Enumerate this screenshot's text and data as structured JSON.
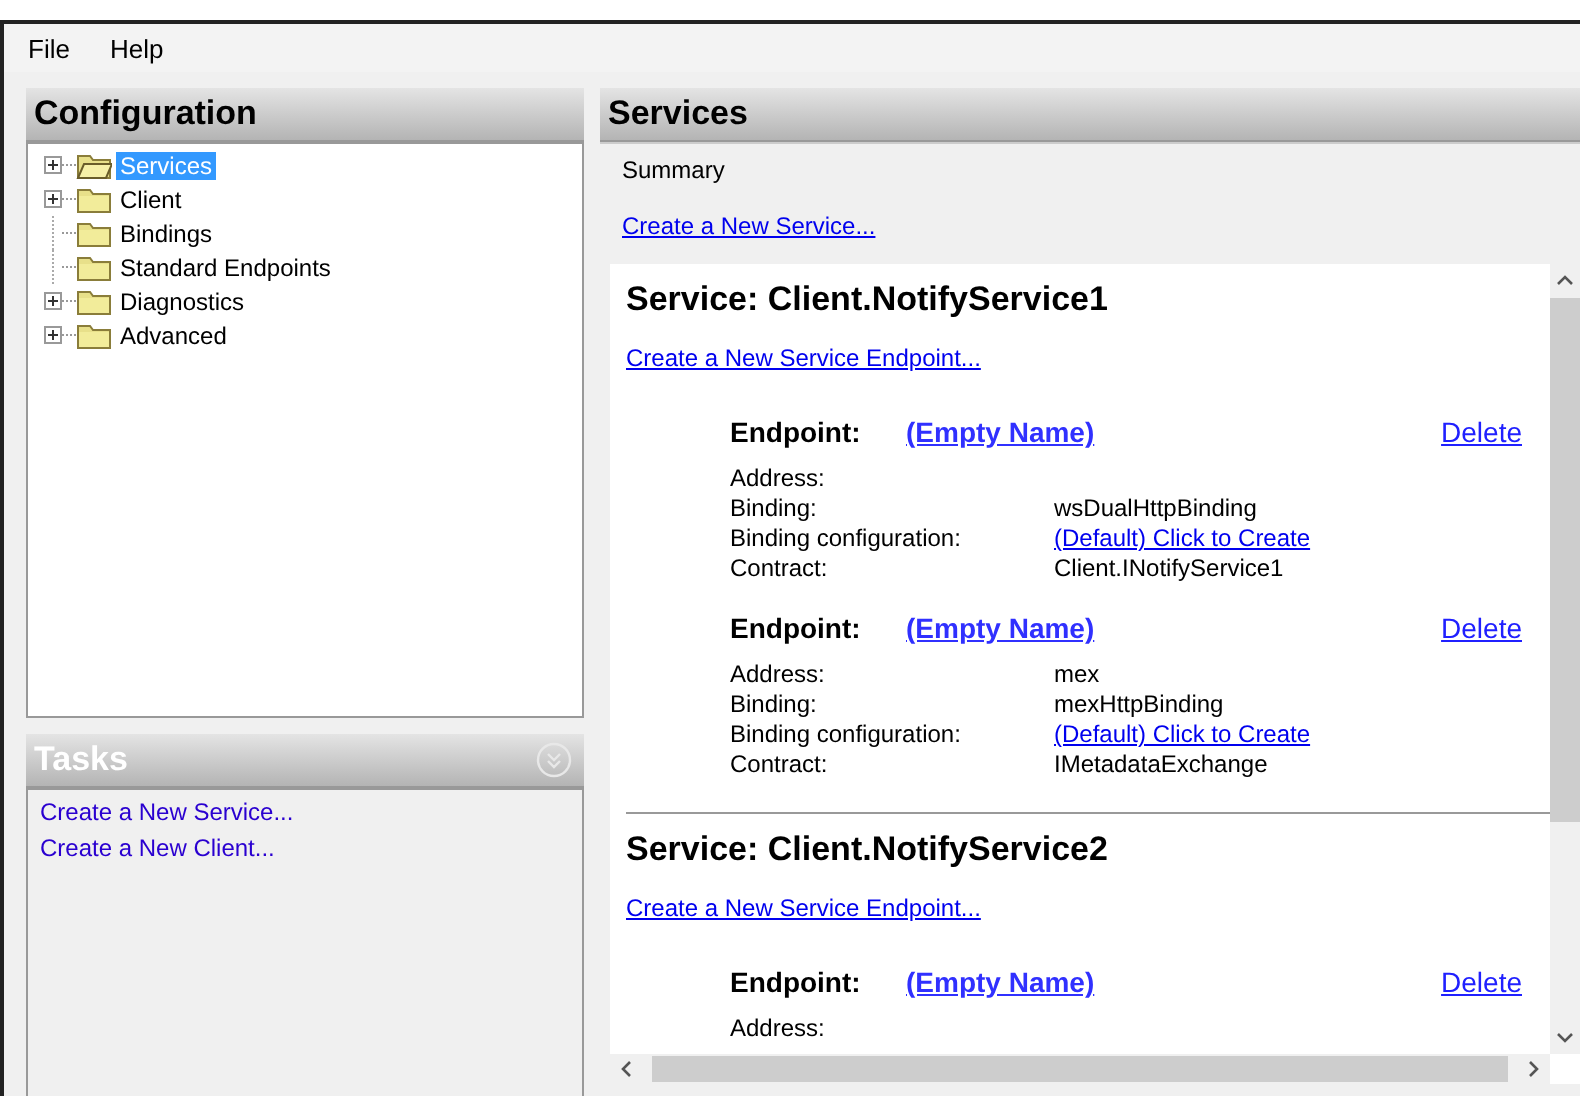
{
  "menu": [
    "File",
    "Help"
  ],
  "configuration": {
    "title": "Configuration",
    "tree": [
      {
        "label": "Services",
        "expandable": true,
        "selected": true,
        "open_folder": true
      },
      {
        "label": "Client",
        "expandable": true,
        "selected": false,
        "open_folder": false
      },
      {
        "label": "Bindings",
        "expandable": false,
        "selected": false,
        "open_folder": false
      },
      {
        "label": "Standard Endpoints",
        "expandable": false,
        "selected": false,
        "open_folder": false
      },
      {
        "label": "Diagnostics",
        "expandable": true,
        "selected": false,
        "open_folder": false
      },
      {
        "label": "Advanced",
        "expandable": true,
        "selected": false,
        "open_folder": false
      }
    ]
  },
  "tasks": {
    "title": "Tasks",
    "links": [
      "Create a New Service...",
      "Create a New Client..."
    ]
  },
  "services_panel": {
    "title": "Services",
    "summary_label": "Summary",
    "create_link": "Create a New Service...",
    "services": [
      {
        "title": "Service: Client.NotifyService1",
        "create_endpoint_link": "Create a New Service Endpoint...",
        "endpoints": [
          {
            "label": "Endpoint:",
            "name": "(Empty Name)",
            "delete": "Delete",
            "properties": [
              {
                "label": "Address:"
              },
              {
                "label": "Binding:",
                "value": "wsDualHttpBinding",
                "kind": "text"
              },
              {
                "label": "Binding configuration:",
                "value": "(Default) Click to Create",
                "kind": "link"
              },
              {
                "label": "Contract:",
                "value": "Client.INotifyService1",
                "kind": "text"
              }
            ]
          },
          {
            "label": "Endpoint:",
            "name": "(Empty Name)",
            "delete": "Delete",
            "properties": [
              {
                "label": "Address:",
                "value": "mex",
                "kind": "text"
              },
              {
                "label": "Binding:",
                "value": "mexHttpBinding",
                "kind": "text"
              },
              {
                "label": "Binding configuration:",
                "value": "(Default) Click to Create",
                "kind": "link"
              },
              {
                "label": "Contract:",
                "value": "IMetadataExchange",
                "kind": "text"
              }
            ]
          }
        ]
      },
      {
        "title": "Service: Client.NotifyService2",
        "create_endpoint_link": "Create a New Service Endpoint...",
        "endpoints": [
          {
            "label": "Endpoint:",
            "name": "(Empty Name)",
            "delete": "Delete",
            "properties": [
              {
                "label": "Address:"
              }
            ]
          }
        ]
      }
    ]
  }
}
